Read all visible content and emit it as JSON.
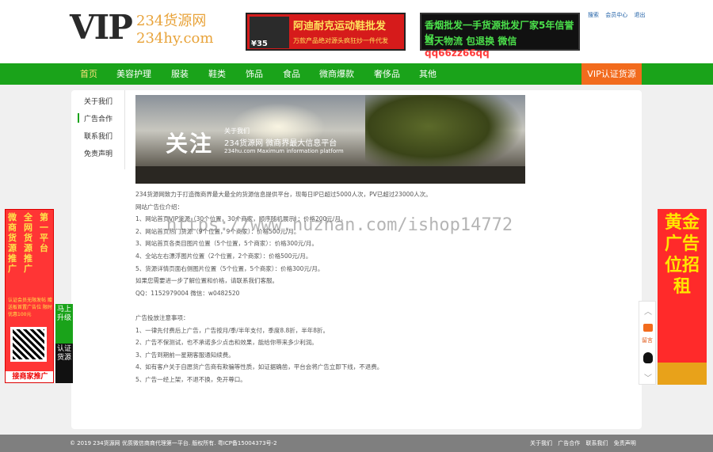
{
  "header": {
    "logo_vip": "VIP",
    "logo_cn": "234货源网",
    "logo_domain": "234hy.com",
    "banner1": {
      "title": "阿迪耐克运动鞋批发",
      "sub": "万款产品绝对源头疯狂炒一件代发",
      "price": "¥35"
    },
    "banner2": {
      "line1": "香烟批发一手货源批发厂家5年信誉好",
      "line2_prefix": "当天物流 包退换 微信",
      "wechat": "qq66zz66qq"
    },
    "toplinks": [
      "搜索",
      "会员中心",
      "退出"
    ]
  },
  "nav": {
    "items": [
      "首页",
      "美容护理",
      "服装",
      "鞋类",
      "饰品",
      "食品",
      "微商爆款",
      "奢侈品",
      "其他"
    ],
    "active": "首页",
    "vip": "VIP认证货源"
  },
  "sidebar": {
    "items": [
      "关于我们",
      "广告合作",
      "联系我们",
      "免责声明"
    ]
  },
  "hero": {
    "big": "关注",
    "small1": "关于我们",
    "small2": "234货源网 微商界最大信息平台",
    "small3": "234hu.com Maximum information platform"
  },
  "content": {
    "lines": [
      "234货源网致力于打造微商界最大最全的货源信息提供平台，现每日IP已超过5000人次，PV已超过23000人次。",
      "网站广告位介绍：",
      "1、网站首页VIP货源（30个位置，30个商家，顺序随机展示）：价格200元/月。",
      "2、网站首页热门货源（9个位置，9个商家）：价格500元/月。",
      "3、网站首页各类目图片位置（5个位置，5个商家）：价格300元/月。",
      "4、全站左右漂浮图片位置（2个位置，2个商家）：价格500元/月。",
      "5、货源详情页面右侧图片位置（5个位置，5个商家）：价格300元/月。",
      "如果您需要进一步了解位置和价格，请联系我们客服。",
      "QQ：1152979004    微信：w0482520",
      "",
      "广告投放注意事项：",
      "1、一律先付费后上广告，广告按月/季/半年支付，季度8.8折，半年8折。",
      "2、广告不保测试，也不承诺多少点击和效果，能给你带来多少利润。",
      "3、广告到期前一星期客服通知续费。",
      "4、如有客户关于自愿货广告商有欺骗等性质，如证据确凿，平台会将广告立即下线，不退费。",
      "5、广告一经上架，不退不换，免开尊口。"
    ]
  },
  "footer": {
    "copyright": "© 2019  234货源网 优质微信商商代理第一平台.  版权所有.  粤ICP备15004373号-2",
    "links": [
      "关于我们",
      "广告合作",
      "联系我们",
      "免责声明"
    ]
  },
  "ads": {
    "left_cols": [
      "微商货源推广",
      "全网货源推广",
      "第一平台"
    ],
    "left_small": "认证会员无限发帖 赠送板首置广告位 限时优惠100元",
    "left_bottom": "接商家推广",
    "left_tab_top": "马上升级",
    "left_tab_bottom": "认证货源",
    "right_text": "黄金广告位招租",
    "float_msg": "留言"
  },
  "watermark": "https://www.huzhan.com/ishop14772"
}
